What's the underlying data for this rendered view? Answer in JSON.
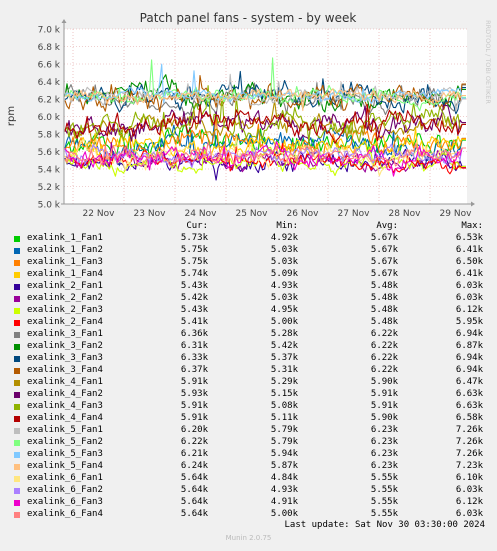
{
  "chart_data": {
    "type": "line",
    "title": "Patch panel fans - system - by week",
    "ylabel": "rpm",
    "side_label": "RRDTOOL / TOBI OETIKER",
    "ylim": [
      5000,
      7000
    ],
    "yticks": [
      "5.0 k",
      "5.2 k",
      "5.4 k",
      "5.6 k",
      "5.8 k",
      "6.0 k",
      "6.2 k",
      "6.4 k",
      "6.6 k",
      "6.8 k",
      "7.0 k"
    ],
    "xticks": [
      "22 Nov",
      "23 Nov",
      "24 Nov",
      "25 Nov",
      "26 Nov",
      "27 Nov",
      "28 Nov",
      "29 Nov"
    ],
    "grid": true,
    "columns": [
      "Cur:",
      "Min:",
      "Avg:",
      "Max:"
    ],
    "series": [
      {
        "name": "exalink_1_Fan1",
        "color": "#00cc00",
        "cur": "5.73k",
        "min": "4.92k",
        "avg": "5.67k",
        "max": "6.53k"
      },
      {
        "name": "exalink_1_Fan2",
        "color": "#0066b3",
        "cur": "5.75k",
        "min": "5.03k",
        "avg": "5.67k",
        "max": "6.41k"
      },
      {
        "name": "exalink_1_Fan3",
        "color": "#ff8000",
        "cur": "5.75k",
        "min": "5.03k",
        "avg": "5.67k",
        "max": "6.50k"
      },
      {
        "name": "exalink_1_Fan4",
        "color": "#ffcc00",
        "cur": "5.74k",
        "min": "5.09k",
        "avg": "5.67k",
        "max": "6.41k"
      },
      {
        "name": "exalink_2_Fan1",
        "color": "#330099",
        "cur": "5.43k",
        "min": "4.93k",
        "avg": "5.48k",
        "max": "6.03k"
      },
      {
        "name": "exalink_2_Fan2",
        "color": "#990099",
        "cur": "5.42k",
        "min": "5.03k",
        "avg": "5.48k",
        "max": "6.03k"
      },
      {
        "name": "exalink_2_Fan3",
        "color": "#ccff00",
        "cur": "5.43k",
        "min": "4.95k",
        "avg": "5.48k",
        "max": "6.12k"
      },
      {
        "name": "exalink_2_Fan4",
        "color": "#ff0000",
        "cur": "5.41k",
        "min": "5.00k",
        "avg": "5.48k",
        "max": "5.95k"
      },
      {
        "name": "exalink_3_Fan1",
        "color": "#808080",
        "cur": "6.36k",
        "min": "5.28k",
        "avg": "6.22k",
        "max": "6.94k"
      },
      {
        "name": "exalink_3_Fan2",
        "color": "#008f00",
        "cur": "6.31k",
        "min": "5.42k",
        "avg": "6.22k",
        "max": "6.87k"
      },
      {
        "name": "exalink_3_Fan3",
        "color": "#00487d",
        "cur": "6.33k",
        "min": "5.37k",
        "avg": "6.22k",
        "max": "6.94k"
      },
      {
        "name": "exalink_3_Fan4",
        "color": "#b35a00",
        "cur": "6.37k",
        "min": "5.31k",
        "avg": "6.22k",
        "max": "6.94k"
      },
      {
        "name": "exalink_4_Fan1",
        "color": "#b38f00",
        "cur": "5.91k",
        "min": "5.29k",
        "avg": "5.90k",
        "max": "6.47k"
      },
      {
        "name": "exalink_4_Fan2",
        "color": "#6b006b",
        "cur": "5.93k",
        "min": "5.15k",
        "avg": "5.91k",
        "max": "6.63k"
      },
      {
        "name": "exalink_4_Fan3",
        "color": "#8fb300",
        "cur": "5.91k",
        "min": "5.08k",
        "avg": "5.91k",
        "max": "6.63k"
      },
      {
        "name": "exalink_4_Fan4",
        "color": "#b30000",
        "cur": "5.91k",
        "min": "5.11k",
        "avg": "5.90k",
        "max": "6.58k"
      },
      {
        "name": "exalink_5_Fan1",
        "color": "#bebebe",
        "cur": "6.20k",
        "min": "5.79k",
        "avg": "6.23k",
        "max": "7.26k"
      },
      {
        "name": "exalink_5_Fan2",
        "color": "#80ff80",
        "cur": "6.22k",
        "min": "5.79k",
        "avg": "6.23k",
        "max": "7.26k"
      },
      {
        "name": "exalink_5_Fan3",
        "color": "#80c9ff",
        "cur": "6.21k",
        "min": "5.94k",
        "avg": "6.23k",
        "max": "7.26k"
      },
      {
        "name": "exalink_5_Fan4",
        "color": "#ffc080",
        "cur": "6.24k",
        "min": "5.87k",
        "avg": "6.23k",
        "max": "7.23k"
      },
      {
        "name": "exalink_6_Fan1",
        "color": "#ffe680",
        "cur": "5.64k",
        "min": "4.84k",
        "avg": "5.55k",
        "max": "6.10k"
      },
      {
        "name": "exalink_6_Fan2",
        "color": "#aa80ff",
        "cur": "5.64k",
        "min": "4.93k",
        "avg": "5.55k",
        "max": "6.03k"
      },
      {
        "name": "exalink_6_Fan3",
        "color": "#ee00cc",
        "cur": "5.64k",
        "min": "4.91k",
        "avg": "5.55k",
        "max": "6.12k"
      },
      {
        "name": "exalink_6_Fan4",
        "color": "#ff8080",
        "cur": "5.64k",
        "min": "5.00k",
        "avg": "5.55k",
        "max": "6.03k"
      }
    ]
  },
  "footer": {
    "last_update": "Last update: Sat Nov 30 03:30:00 2024",
    "version": "Munin 2.0.75"
  }
}
